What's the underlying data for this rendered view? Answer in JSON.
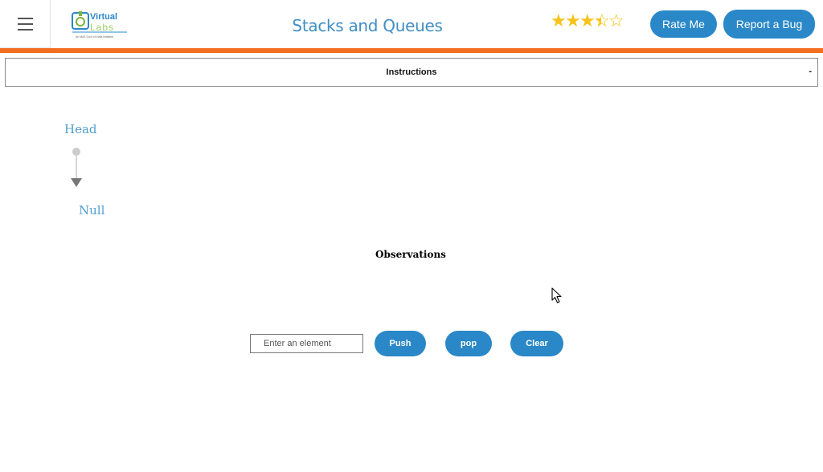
{
  "header": {
    "title": "Stacks and Queues",
    "logo": {
      "name": "Virtual Labs",
      "tagline": "An MoE Govt of India Initiative"
    },
    "rating": {
      "value": 3.5,
      "max": 5,
      "star_color": "#f7c31b"
    },
    "rate_label": "Rate Me",
    "bug_label": "Report a Bug"
  },
  "instructions": {
    "label": "Instructions",
    "caret": "-"
  },
  "diagram": {
    "head_label": "Head",
    "null_label": "Null"
  },
  "observations": {
    "label": "Observations"
  },
  "controls": {
    "input_placeholder": "Enter an element",
    "input_value": "",
    "push_label": "Push",
    "pop_label": "pop",
    "clear_label": "Clear"
  },
  "colors": {
    "accent": "#2a88c8",
    "header_bar": "#f26f21",
    "title": "#3f8fc3"
  }
}
